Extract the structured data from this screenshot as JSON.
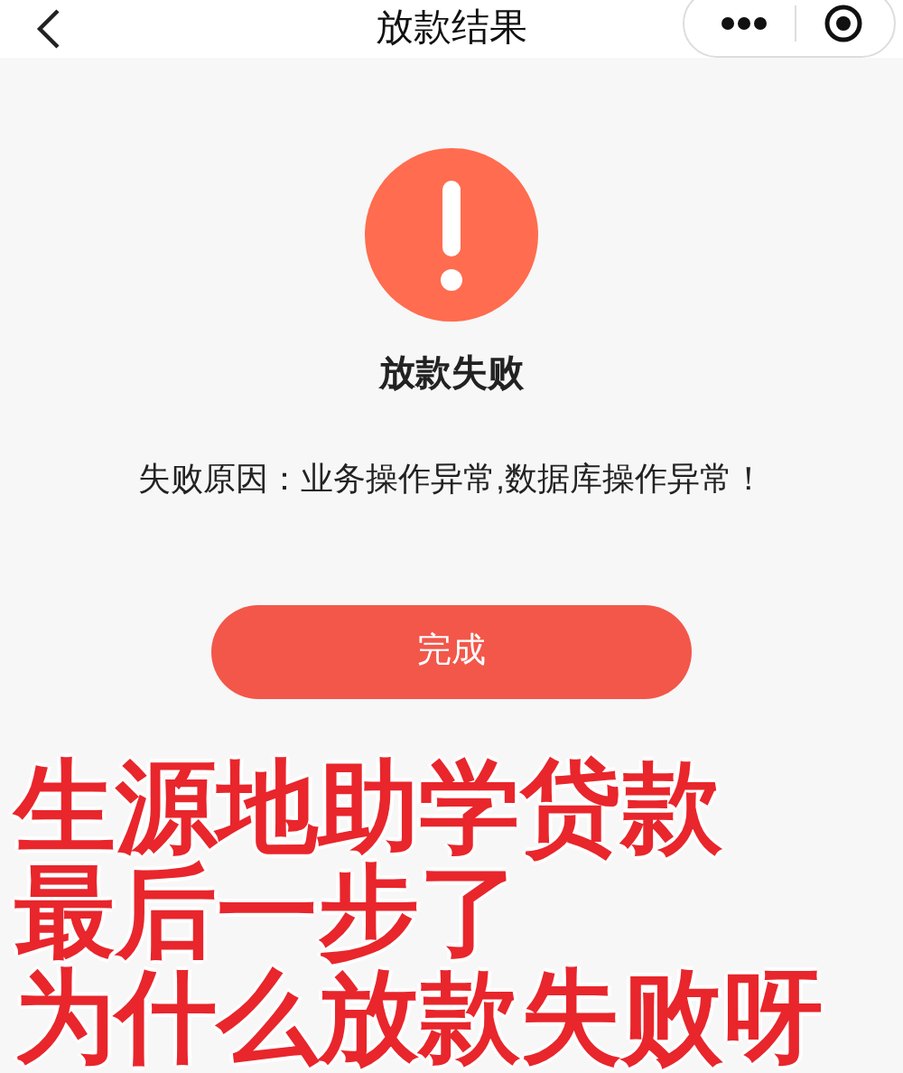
{
  "nav_bar": {
    "title": "放款结果"
  },
  "result": {
    "title": "放款失败",
    "reason": "失败原因：业务操作异常,数据库操作异常！"
  },
  "buttons": [
    "完成"
  ],
  "caption": [
    "生源地助学贷款",
    "最后一步了",
    "为什么放款失败呀"
  ]
}
